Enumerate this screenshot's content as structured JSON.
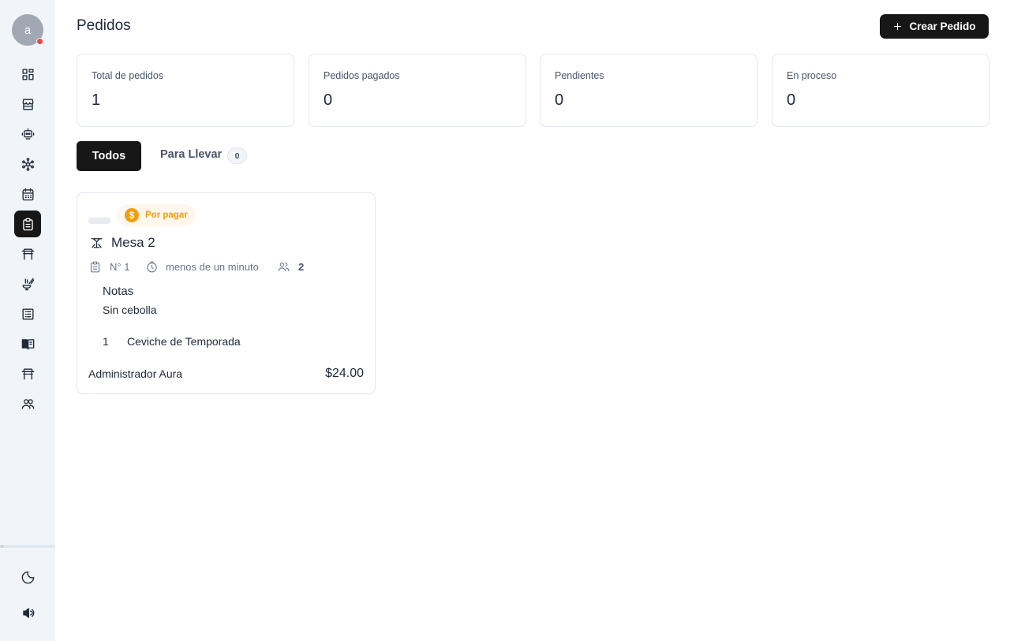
{
  "user": {
    "avatar_initial": "a"
  },
  "sidebar": {
    "items": [
      {
        "icon": "dashboard-icon"
      },
      {
        "icon": "store-icon"
      },
      {
        "icon": "robot-icon"
      },
      {
        "icon": "network-icon"
      },
      {
        "icon": "calendar-icon"
      },
      {
        "icon": "clipboard-icon",
        "active": true
      },
      {
        "icon": "table-icon"
      },
      {
        "icon": "kitchen-icon"
      },
      {
        "icon": "list-icon"
      },
      {
        "icon": "menu-book-icon"
      },
      {
        "icon": "store-front-icon"
      },
      {
        "icon": "users-icon"
      }
    ],
    "bottom": [
      {
        "icon": "moon-icon"
      },
      {
        "icon": "volume-icon"
      }
    ]
  },
  "header": {
    "title": "Pedidos",
    "create_label": "Crear Pedido"
  },
  "stats": [
    {
      "label": "Total de pedidos",
      "value": "1"
    },
    {
      "label": "Pedidos pagados",
      "value": "0"
    },
    {
      "label": "Pendientes",
      "value": "0"
    },
    {
      "label": "En proceso",
      "value": "0"
    }
  ],
  "tabs": {
    "all_label": "Todos",
    "takeaway_label": "Para Llevar",
    "takeaway_count": "0"
  },
  "order": {
    "status": "Por pagar",
    "status_symbol": "$",
    "table": "Mesa 2",
    "number": "N° 1",
    "elapsed": "menos de un minuto",
    "guests": "2",
    "notes_title": "Notas",
    "notes": "Sin cebolla",
    "items": [
      {
        "qty": "1",
        "name": "Ceviche de Temporada"
      }
    ],
    "user": "Administrador Aura",
    "total": "$24.00"
  },
  "colors": {
    "accent": "#171717",
    "pending": "#f59e0b",
    "notification": "#ef4444"
  }
}
